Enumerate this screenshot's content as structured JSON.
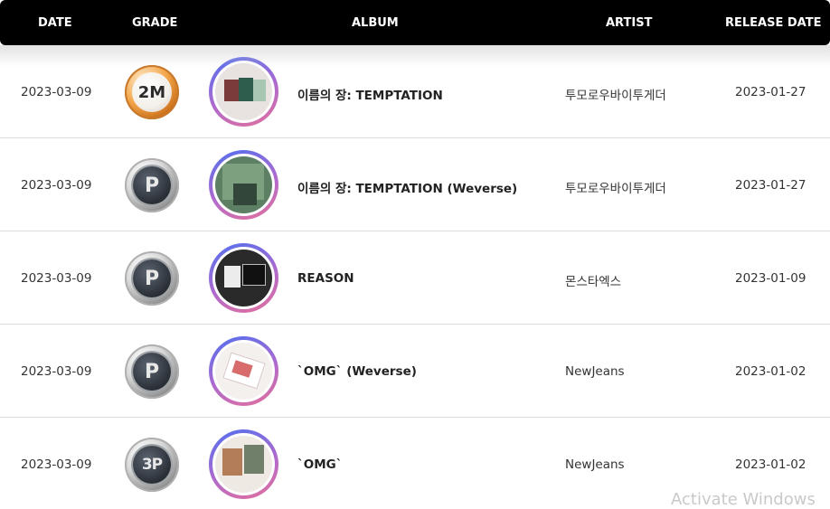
{
  "header": {
    "date": "DATE",
    "grade": "GRADE",
    "album": "ALBUM",
    "artist": "ARTIST",
    "release_date": "RELEASE DATE"
  },
  "rows": [
    {
      "date": "2023-03-09",
      "grade": "2M",
      "grade_type": "gold",
      "album": "이름의 장: TEMPTATION",
      "artist": "투모로우바이투게더",
      "release_date": "2023-01-27"
    },
    {
      "date": "2023-03-09",
      "grade": "P",
      "grade_type": "platinum",
      "album": "이름의 장: TEMPTATION (Weverse)",
      "artist": "투모로우바이투게더",
      "release_date": "2023-01-27"
    },
    {
      "date": "2023-03-09",
      "grade": "P",
      "grade_type": "platinum",
      "album": "REASON",
      "artist": "몬스타엑스",
      "release_date": "2023-01-09"
    },
    {
      "date": "2023-03-09",
      "grade": "P",
      "grade_type": "platinum",
      "album": "`OMG` (Weverse)",
      "artist": "NewJeans",
      "release_date": "2023-01-02"
    },
    {
      "date": "2023-03-09",
      "grade": "3P",
      "grade_type": "platinum",
      "album": "`OMG`",
      "artist": "NewJeans",
      "release_date": "2023-01-02"
    }
  ],
  "watermark": "Activate Windows",
  "colors": {
    "header_bg": "#000000",
    "cover_ring_start": "#4f6ff0",
    "cover_ring_end": "#e4709a"
  }
}
